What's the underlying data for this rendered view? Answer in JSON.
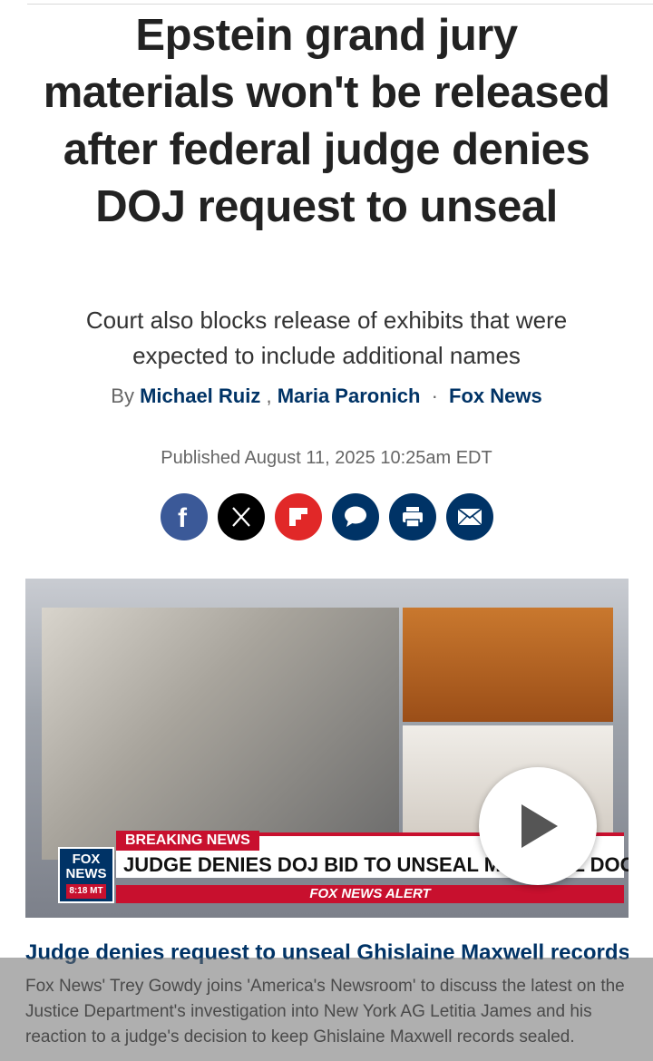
{
  "article": {
    "headline": "Epstein grand jury materials won't be released after federal judge denies DOJ request to unseal",
    "subhead": "Court also blocks release of exhibits that were expected to include additional names",
    "byline": {
      "prefix": "By",
      "author1": "Michael Ruiz",
      "separator": ",",
      "author2": "Maria Paronich",
      "dot": "·",
      "outlet": "Fox News"
    },
    "published": {
      "label": "Published",
      "datetime": "August 11, 2025 10:25am EDT"
    }
  },
  "share_buttons": [
    {
      "name": "facebook",
      "icon": "facebook-icon",
      "color": "#3b5998"
    },
    {
      "name": "x",
      "icon": "x-icon",
      "color": "#000000"
    },
    {
      "name": "flipboard",
      "icon": "flipboard-icon",
      "color": "#e12828"
    },
    {
      "name": "comments",
      "icon": "comment-icon",
      "color": "#003366"
    },
    {
      "name": "print",
      "icon": "print-icon",
      "color": "#003366"
    },
    {
      "name": "email",
      "icon": "email-icon",
      "color": "#003366"
    }
  ],
  "video": {
    "breaking_label": "BREAKING NEWS",
    "chyron": "JUDGE DENIES DOJ BID TO UNSEAL MAXWELL DOCS",
    "alert_label": "FOX NEWS ALERT",
    "logo_line1": "FOX",
    "logo_line2": "NEWS",
    "logo_time": "8:18 MT",
    "play_icon": "play-icon"
  },
  "caption": {
    "title": "Judge denies request to unseal Ghislaine Maxwell records",
    "description": "Fox News' Trey Gowdy joins 'America's Newsroom' to discuss the latest on the Justice Department's investigation into New York AG Letitia James and his reaction to a judge's decision to keep Ghislaine Maxwell records sealed."
  },
  "colors": {
    "link": "#003366",
    "accent_red": "#c8102e"
  }
}
